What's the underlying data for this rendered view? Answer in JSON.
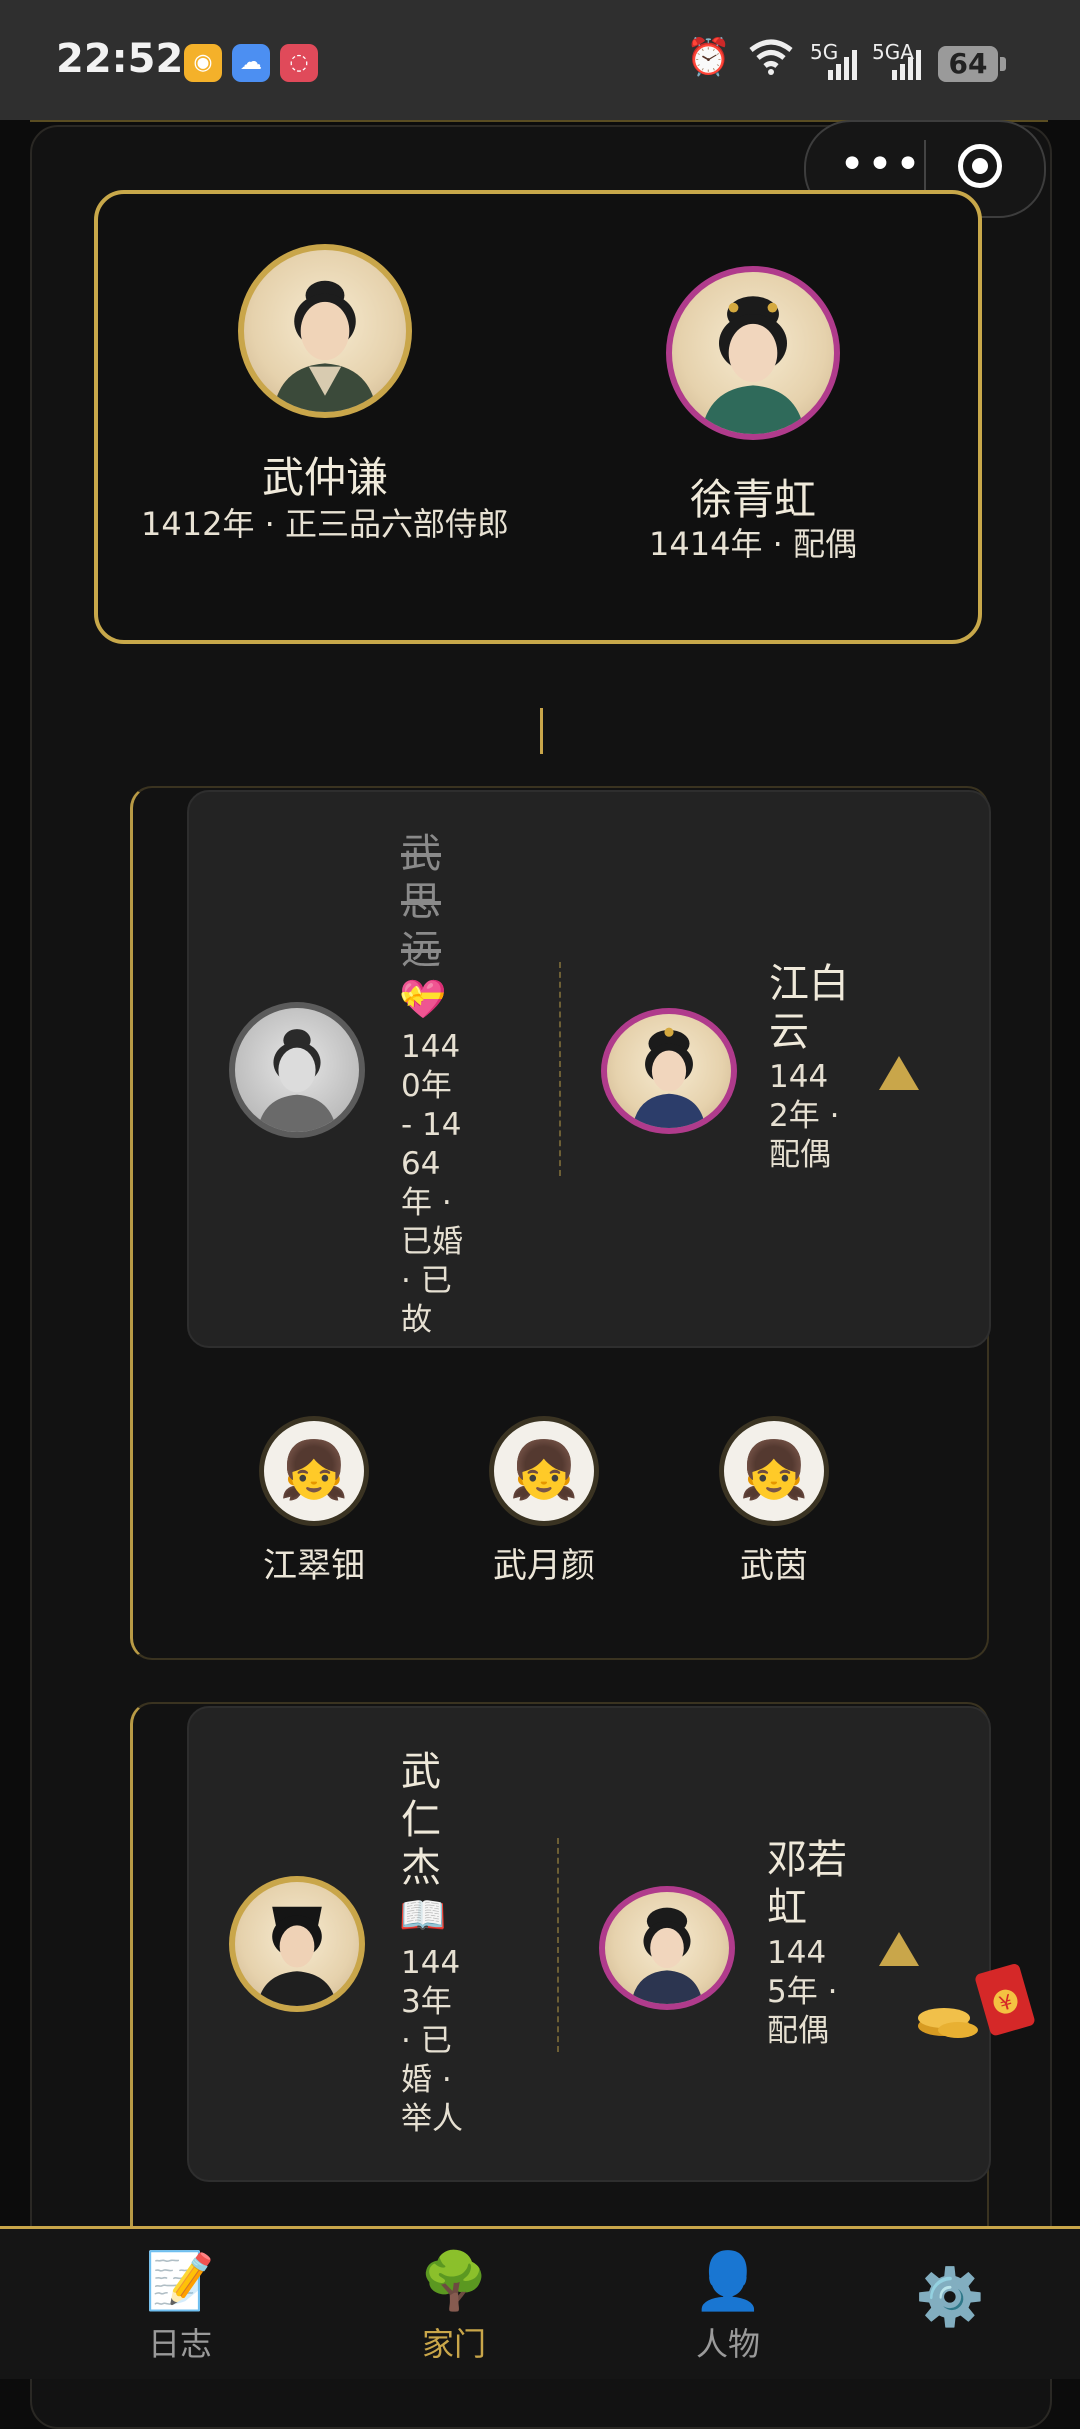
{
  "status_bar": {
    "time": "22:52",
    "network_1": "5G",
    "network_2": "5GA",
    "battery": "64"
  },
  "capsule": {
    "more": "•••"
  },
  "parents": {
    "father": {
      "name": "武仲谦",
      "info": "1412年 · 正三品六部侍郎"
    },
    "mother": {
      "name": "徐青虹",
      "info": "1414年 · 配偶"
    }
  },
  "families": [
    {
      "member": {
        "name": "武思远",
        "badge": "💝",
        "info": "1440年 - 1464年 · 已婚 · 已故",
        "deceased": true
      },
      "spouse": {
        "name": "江白云",
        "info": "1442年 · 配偶"
      },
      "children": [
        {
          "name": "江翠钿",
          "icon": "👧"
        },
        {
          "name": "武月颜",
          "icon": "👧"
        },
        {
          "name": "武茵",
          "icon": "👧"
        }
      ]
    },
    {
      "member": {
        "name": "武仁杰",
        "badge": "📖",
        "info": "1443年 · 已婚 · 举人",
        "deceased": false
      },
      "spouse": {
        "name": "邓若虹",
        "info": "1445年 · 配偶"
      }
    }
  ],
  "tabs": [
    {
      "label": "日志",
      "icon": "📝",
      "active": false
    },
    {
      "label": "家门",
      "icon": "🌳",
      "active": true
    },
    {
      "label": "人物",
      "icon": "👤",
      "active": false
    },
    {
      "label": "",
      "icon": "⚙️",
      "active": false
    }
  ],
  "colors": {
    "accent_gold": "#c9a64a",
    "spouse_pink": "#b03b8c",
    "background": "#0c0c0c"
  }
}
